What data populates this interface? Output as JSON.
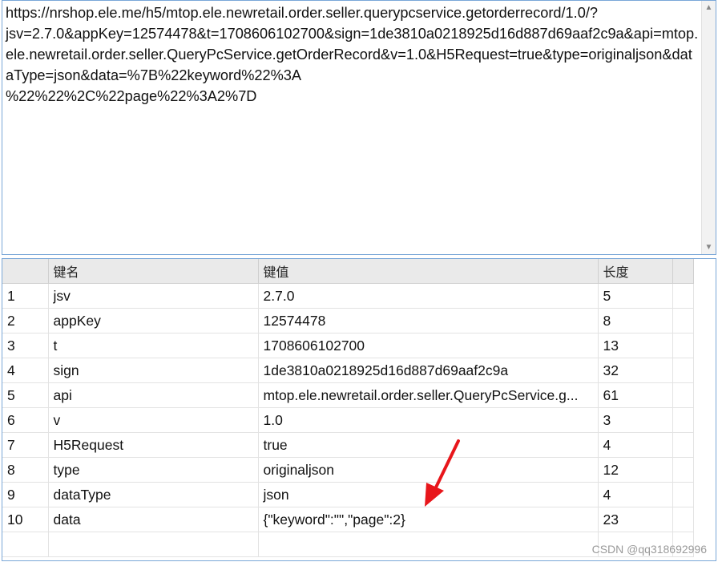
{
  "request": {
    "url_text": "https://nrshop.ele.me/h5/mtop.ele.newretail.order.seller.querypcservice.getorderrecord/1.0/?\njsv=2.7.0&appKey=12574478&t=1708606102700&sign=1de3810a0218925d16d887d69aaf2c9a&api=mtop.ele.newretail.order.seller.QueryPcService.getOrderRecord&v=1.0&H5Request=true&type=originaljson&dataType=json&data=%7B%22keyword%22%3A\n%22%22%2C%22page%22%3A2%7D"
  },
  "table": {
    "headers": [
      "",
      "键名",
      "键值",
      "长度",
      ""
    ],
    "rows": [
      [
        "1",
        "jsv",
        "2.7.0",
        "5"
      ],
      [
        "2",
        "appKey",
        "12574478",
        "8"
      ],
      [
        "3",
        "t",
        "1708606102700",
        "13"
      ],
      [
        "4",
        "sign",
        "1de3810a0218925d16d887d69aaf2c9a",
        "32"
      ],
      [
        "5",
        "api",
        "mtop.ele.newretail.order.seller.QueryPcService.g...",
        "61"
      ],
      [
        "6",
        "v",
        "1.0",
        "3"
      ],
      [
        "7",
        "H5Request",
        "true",
        "4"
      ],
      [
        "8",
        "type",
        "originaljson",
        "12"
      ],
      [
        "9",
        "dataType",
        "json",
        "4"
      ],
      [
        "10",
        "data",
        "{\"keyword\":\"\",\"page\":2}",
        "23"
      ]
    ]
  },
  "watermark": "CSDN @qq318692996",
  "icons": {
    "scroll_up": "chevron-up-icon",
    "scroll_down": "chevron-down-icon",
    "annotation": "red-arrow-icon"
  },
  "colors": {
    "border": "#7aa7d8",
    "header_bg": "#eaeaea",
    "arrow": "#e8161b"
  }
}
